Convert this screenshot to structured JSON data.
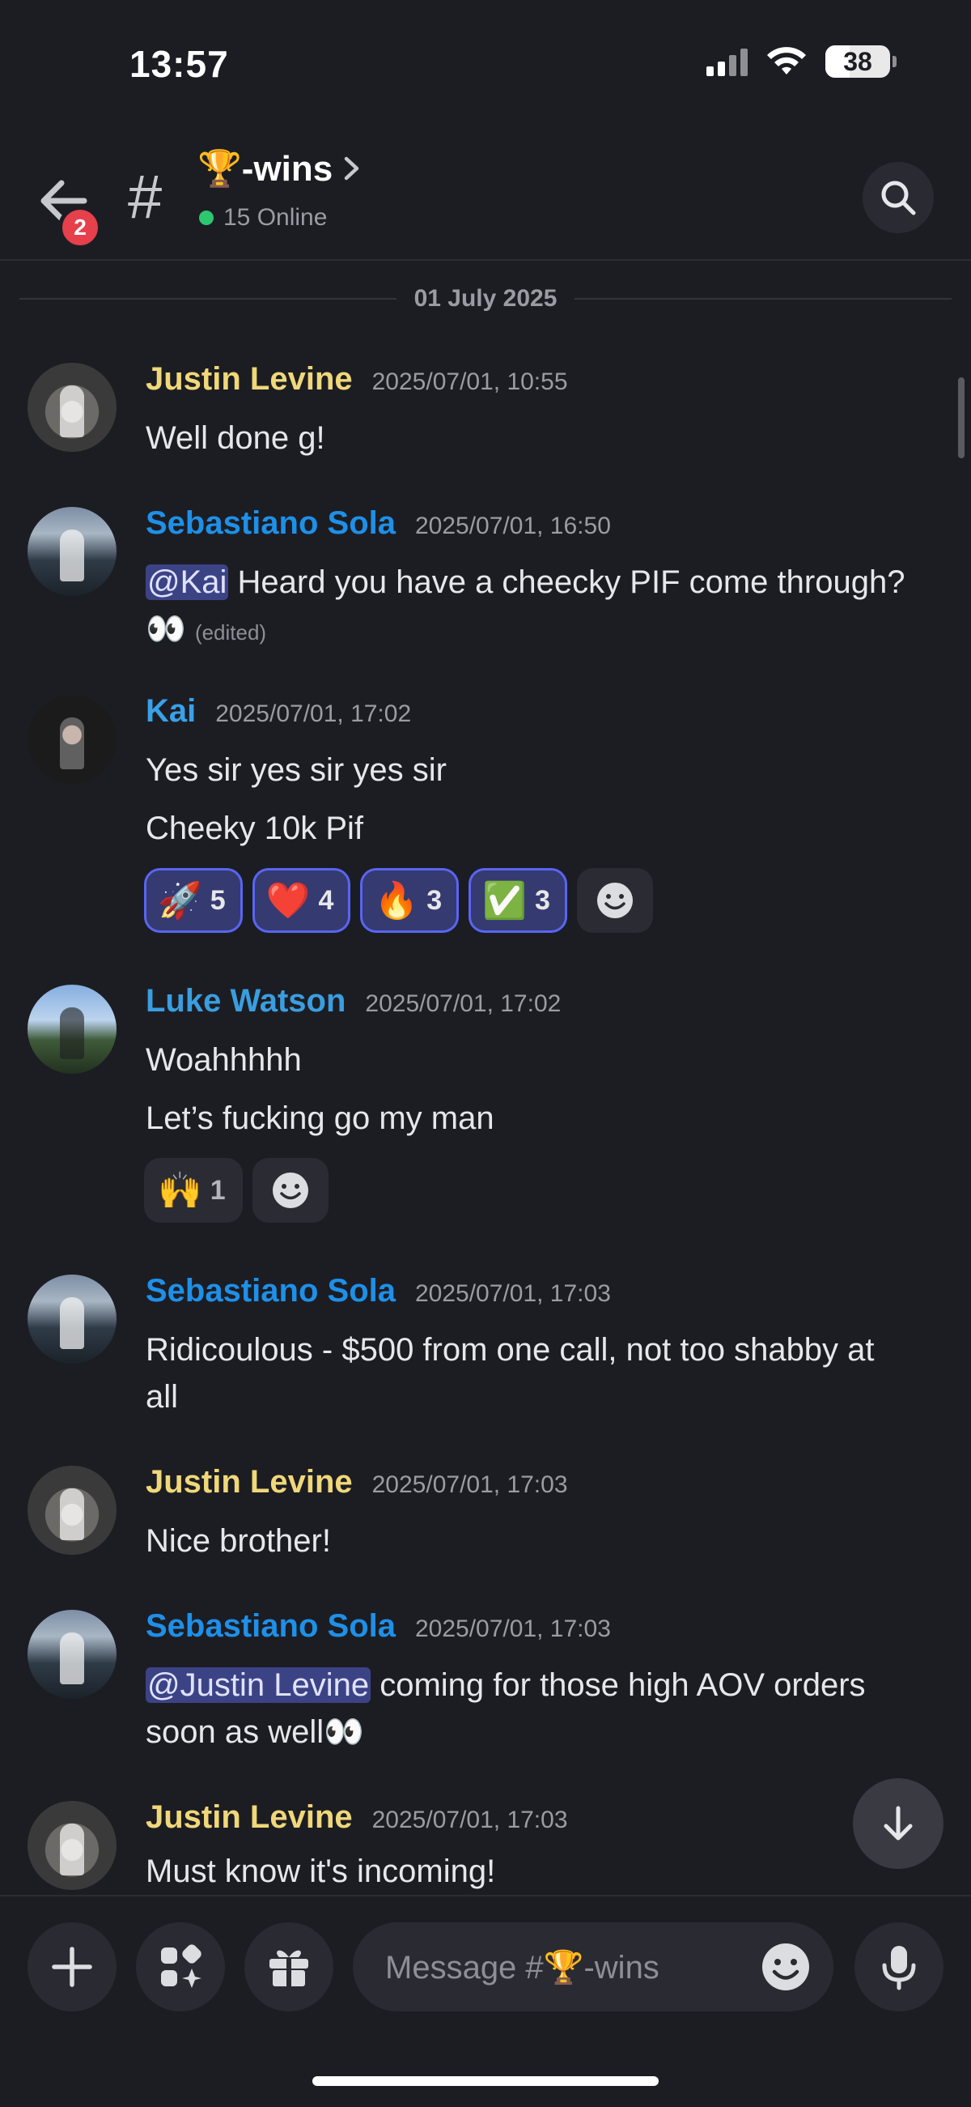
{
  "status_bar": {
    "time": "13:57",
    "battery": "38"
  },
  "header": {
    "back_badge": "2",
    "channel_name": "🏆-wins",
    "online": "15 Online"
  },
  "date_divider": "01 July 2025",
  "messages": [
    {
      "author": "Justin Levine",
      "timestamp": "2025/07/01, 10:55",
      "lines": [
        "Well done g!"
      ]
    },
    {
      "author": "Sebastiano Sola",
      "timestamp": "2025/07/01, 16:50",
      "mention": "@Kai",
      "lines": [
        "Heard you have a cheecky PIF come through?"
      ],
      "eyes": "👀",
      "edited": "(edited)"
    },
    {
      "author": "Kai",
      "timestamp": "2025/07/01, 17:02",
      "lines": [
        "Yes sir yes sir yes sir",
        "Cheeky 10k Pif"
      ],
      "reactions": [
        {
          "emoji": "🚀",
          "count": "5"
        },
        {
          "emoji": "❤️",
          "count": "4"
        },
        {
          "emoji": "🔥",
          "count": "3"
        },
        {
          "emoji": "✅",
          "count": "3"
        }
      ]
    },
    {
      "author": "Luke Watson",
      "timestamp": "2025/07/01, 17:02",
      "lines": [
        "Woahhhhh",
        "Let’s fucking go my man"
      ],
      "reactions": [
        {
          "emoji": "🙌",
          "count": "1"
        }
      ]
    },
    {
      "author": "Sebastiano Sola",
      "timestamp": "2025/07/01, 17:03",
      "lines": [
        "Ridicoulous - $500 from one call, not too shabby at",
        "all"
      ]
    },
    {
      "author": "Justin Levine",
      "timestamp": "2025/07/01, 17:03",
      "lines": [
        "Nice brother!"
      ]
    },
    {
      "author": "Sebastiano Sola",
      "timestamp": "2025/07/01, 17:03",
      "mention": "@Justin Levine",
      "lines": [
        "coming for those high AOV orders",
        "soon as well👀"
      ]
    },
    {
      "author": "Justin Levine",
      "timestamp": "2025/07/01, 17:03",
      "lines": [
        "Must know it's incoming!"
      ]
    }
  ],
  "composer": {
    "placeholder": "Message #🏆-wins"
  },
  "colors": {
    "background": "#1c1d23",
    "accent": "#5865f2",
    "justin": "#f0d779",
    "sebastiano": "#1e90e8",
    "online": "#2dc770",
    "badge": "#e5404b"
  },
  "icons": [
    "back-arrow-icon",
    "hash-icon",
    "chevron-right-icon",
    "search-icon",
    "add-reaction-icon",
    "arrow-down-icon",
    "plus-icon",
    "apps-icon",
    "gift-icon",
    "emoji-icon",
    "microphone-icon"
  ]
}
